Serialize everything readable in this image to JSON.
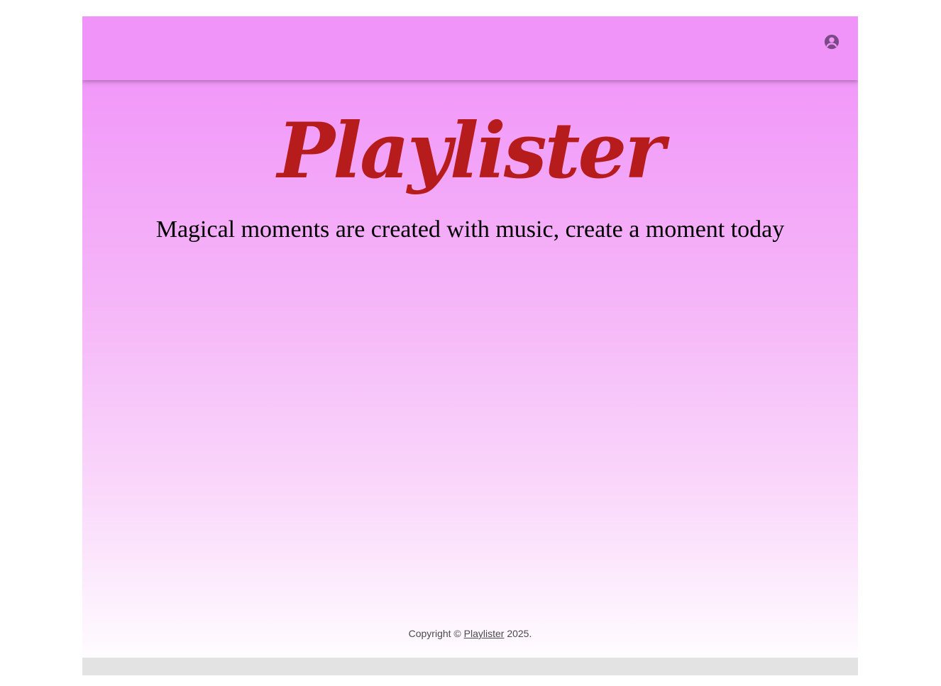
{
  "app": {
    "logo_text": "Playlister",
    "tagline": "Magical moments are created with music, create a moment today",
    "account_icon": "account-circle-icon"
  },
  "footer": {
    "prefix": "Copyright © ",
    "link_label": "Playlister",
    "suffix": " 2025."
  },
  "colors": {
    "topbar": "#f194fa",
    "logo": "#b71c1c",
    "icon": "#7b4a86",
    "bottom_strip": "#e3e3e3"
  }
}
